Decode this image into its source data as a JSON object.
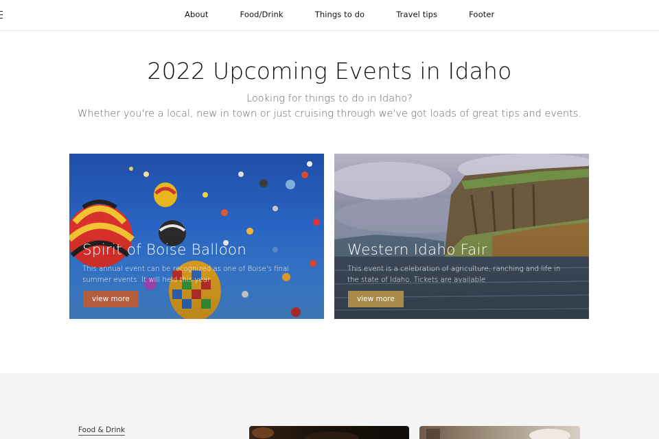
{
  "nav": {
    "items": [
      "About",
      "Food/Drink",
      "Things to do",
      "Travel tips",
      "Footer"
    ]
  },
  "hero": {
    "title": "2022 Upcoming Events in Idaho",
    "subtitle_line1": "Looking for things to do in Idaho?",
    "subtitle_line2": "Whether you're a local, new in town or just cruising through we've got loads of great tips and events."
  },
  "events": [
    {
      "title": "Spirit of Boise Balloon",
      "description": "This annual event can be recognized as one of Boise's final summer events. It will held this year",
      "button": "view more",
      "image_icon": "hot-air-balloons-image",
      "button_color": "#b45d3c"
    },
    {
      "title": "Western Idaho Fair",
      "description": "This event is a celebration of agriculture, ranching and life in the state of Idaho. Tickets are available",
      "button": "view more",
      "image_icon": "cliff-landscape-image",
      "button_color": "#a88b4a"
    }
  ],
  "bottom": {
    "category_link": "Food & Drink"
  }
}
